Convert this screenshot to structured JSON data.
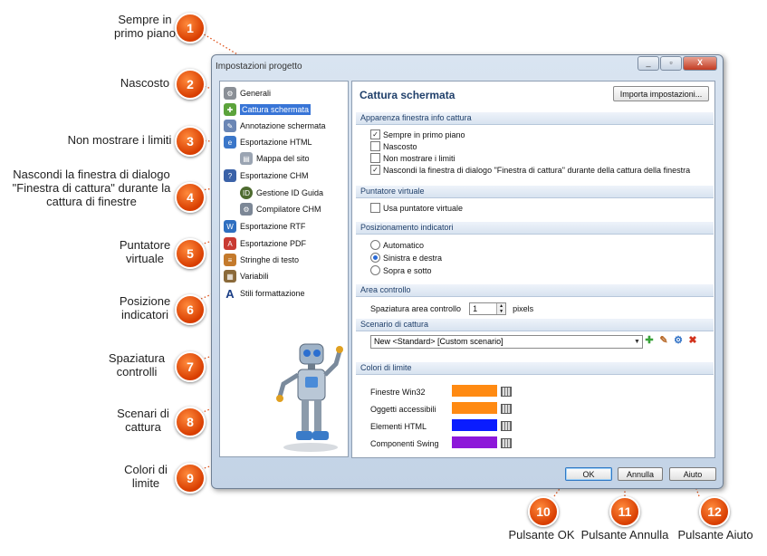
{
  "window": {
    "title": "Impostazioni progetto",
    "controls": [
      "_",
      "▫",
      "X"
    ]
  },
  "sidebar": {
    "items": [
      {
        "label": "Generali",
        "icon": "gear-icon",
        "color": "#8a8f96"
      },
      {
        "label": "Cattura schermata",
        "icon": "capture-icon",
        "color": "#5ca33b",
        "selected": true
      },
      {
        "label": "Annotazione schermata",
        "icon": "annotation-icon",
        "color": "#6a86b5"
      },
      {
        "label": "Esportazione HTML",
        "icon": "html-export-icon",
        "color": "#3a76c9"
      },
      {
        "label": "Mappa del sito",
        "icon": "sitemap-icon",
        "color": "#9aa4b2"
      },
      {
        "label": "Esportazione CHM",
        "icon": "chm-export-icon",
        "color": "#3b62a8"
      },
      {
        "label": "Gestione ID Guida",
        "icon": "id-icon",
        "color": "#4e6b2f"
      },
      {
        "label": "Compilatore CHM",
        "icon": "compiler-icon",
        "color": "#7c8796"
      },
      {
        "label": "Esportazione RTF",
        "icon": "rtf-export-icon",
        "color": "#2f6fc0"
      },
      {
        "label": "Esportazione PDF",
        "icon": "pdf-export-icon",
        "color": "#c93a32"
      },
      {
        "label": "Stringhe di testo",
        "icon": "strings-icon",
        "color": "#c47a2c"
      },
      {
        "label": "Variabili",
        "icon": "variables-icon",
        "color": "#8b6a3a"
      },
      {
        "label": "Stili formattazione",
        "icon": "styles-icon",
        "color": "#1b3f86"
      }
    ]
  },
  "main": {
    "title": "Cattura schermata",
    "import_button": "Importa impostazioni...",
    "sections": {
      "appearance": "Apparenza finestra info cattura",
      "pointer": "Puntatore virtuale",
      "indicators": "Posizionamento indicatori",
      "area": "Area controllo",
      "scenario": "Scenario di cattura",
      "limits": "Colori di limite"
    },
    "appearance_options": [
      {
        "label": "Sempre in primo piano",
        "checked": true
      },
      {
        "label": "Nascosto",
        "checked": false
      },
      {
        "label": "Non mostrare i limiti",
        "checked": false
      },
      {
        "label": "Nascondi la finestra di dialogo \"Finestra di cattura\" durante della cattura della finestra",
        "checked": true
      }
    ],
    "pointer_option": {
      "label": "Usa puntatore virtuale",
      "checked": false
    },
    "indicator_options": [
      {
        "label": "Automatico",
        "selected": false
      },
      {
        "label": "Sinistra e destra",
        "selected": true
      },
      {
        "label": "Sopra e sotto",
        "selected": false
      }
    ],
    "area_spacing": {
      "label": "Spaziatura area controllo",
      "value": "1",
      "unit": "pixels"
    },
    "scenario_value": "New <Standard> [Custom scenario]",
    "scenario_tools": [
      "add-icon",
      "edit-icon",
      "settings-icon",
      "delete-icon"
    ],
    "limit_colors": [
      {
        "label": "Finestre Win32",
        "color": "#ff8a12"
      },
      {
        "label": "Oggetti accessibili",
        "color": "#ff8a12"
      },
      {
        "label": "Elementi HTML",
        "color": "#0a1cff"
      },
      {
        "label": "Componenti Swing",
        "color": "#8d18d9"
      }
    ]
  },
  "footer": {
    "ok": "OK",
    "cancel": "Annulla",
    "help": "Aiuto"
  },
  "callouts": [
    {
      "num": "1",
      "text": "Sempre in primo piano"
    },
    {
      "num": "2",
      "text": "Nascosto"
    },
    {
      "num": "3",
      "text": "Non mostrare i limiti"
    },
    {
      "num": "4",
      "text": "Nascondi la finestra di dialogo \"Finestra di cattura\" durante la cattura di finestre"
    },
    {
      "num": "5",
      "text": "Puntatore virtuale"
    },
    {
      "num": "6",
      "text": "Posizione indicatori"
    },
    {
      "num": "7",
      "text": "Spaziatura controlli"
    },
    {
      "num": "8",
      "text": "Scenari di cattura"
    },
    {
      "num": "9",
      "text": "Colori di limite"
    },
    {
      "num": "10",
      "text": "Pulsante OK"
    },
    {
      "num": "11",
      "text": "Pulsante Annulla"
    },
    {
      "num": "12",
      "text": "Pulsante Aiuto"
    }
  ]
}
